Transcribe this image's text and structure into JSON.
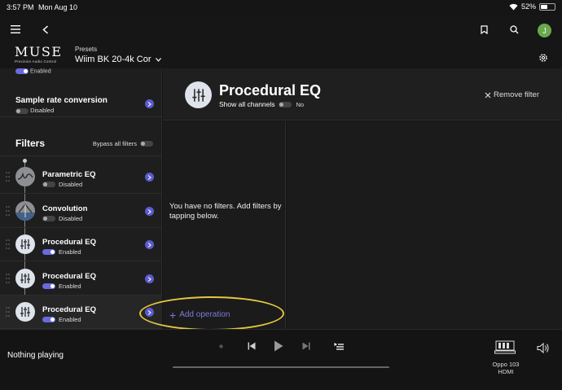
{
  "status": {
    "time": "3:57 PM",
    "date": "Mon Aug 10",
    "battery": "52%",
    "battery_level": 0.52
  },
  "header": {
    "brand": "MUSE",
    "brand_tagline": "Precision Audio Control",
    "presets_label": "Presets",
    "preset_value": "Wiim BK 20-4k Cor",
    "avatar_initial": "J"
  },
  "sidebar": {
    "top_stub_state": "Enabled",
    "sample_rate": {
      "title": "Sample rate conversion",
      "state": "Disabled"
    },
    "filters_title": "Filters",
    "bypass_label": "Bypass all filters",
    "filters": [
      {
        "name": "Parametric EQ",
        "state": "Disabled",
        "enabled": false,
        "icon": "parametric-eq-icon"
      },
      {
        "name": "Convolution",
        "state": "Disabled",
        "enabled": false,
        "icon": "convolution-icon"
      },
      {
        "name": "Procedural EQ",
        "state": "Enabled",
        "enabled": true,
        "icon": "sliders-icon"
      },
      {
        "name": "Procedural EQ",
        "state": "Enabled",
        "enabled": true,
        "icon": "sliders-icon"
      },
      {
        "name": "Procedural EQ",
        "state": "Enabled",
        "enabled": true,
        "icon": "sliders-icon"
      }
    ]
  },
  "main": {
    "title": "Procedural EQ",
    "show_all_label": "Show all channels",
    "show_all_value": "No",
    "remove_label": "Remove filter",
    "empty_text": "You have no filters. Add filters by tapping below.",
    "add_operation": "Add operation"
  },
  "player": {
    "now_playing": "Nothing playing",
    "device_name": "Oppo 103",
    "device_input": "HDMI"
  },
  "colors": {
    "accent": "#5b5bcf",
    "highlight": "#e6c640",
    "avatar": "#6aa84f"
  }
}
